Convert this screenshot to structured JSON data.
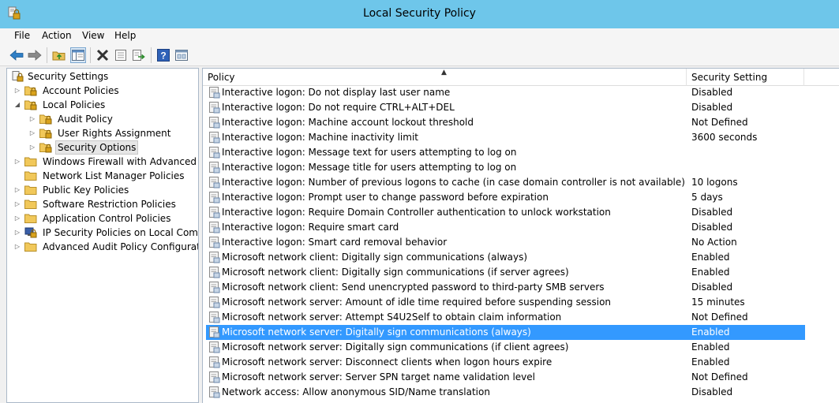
{
  "window": {
    "title": "Local Security Policy"
  },
  "menu": {
    "file": "File",
    "action": "Action",
    "view": "View",
    "help": "Help"
  },
  "toolbar": {
    "buttons": [
      "back-icon",
      "forward-icon",
      "up-folder-icon",
      "show-hide-tree-icon",
      "delete-icon",
      "properties-icon",
      "export-list-icon",
      "help-icon",
      "console-icon"
    ]
  },
  "tree": {
    "root": "Security Settings",
    "items": [
      {
        "label": "Account Policies"
      },
      {
        "label": "Local Policies"
      },
      {
        "label": "Audit Policy"
      },
      {
        "label": "User Rights Assignment"
      },
      {
        "label": "Security Options"
      },
      {
        "label": "Windows Firewall with Advanced Security"
      },
      {
        "label": "Network List Manager Policies"
      },
      {
        "label": "Public Key Policies"
      },
      {
        "label": "Software Restriction Policies"
      },
      {
        "label": "Application Control Policies"
      },
      {
        "label": "IP Security Policies on Local Computer"
      },
      {
        "label": "Advanced Audit Policy Configuration"
      }
    ]
  },
  "list": {
    "columns": {
      "policy": "Policy",
      "setting": "Security Setting"
    },
    "rows": [
      {
        "policy": "Interactive logon: Do not display last user name",
        "setting": "Disabled"
      },
      {
        "policy": "Interactive logon: Do not require CTRL+ALT+DEL",
        "setting": "Disabled"
      },
      {
        "policy": "Interactive logon: Machine account lockout threshold",
        "setting": "Not Defined"
      },
      {
        "policy": "Interactive logon: Machine inactivity limit",
        "setting": "3600 seconds"
      },
      {
        "policy": "Interactive logon: Message text for users attempting to log on",
        "setting": ""
      },
      {
        "policy": "Interactive logon: Message title for users attempting to log on",
        "setting": ""
      },
      {
        "policy": "Interactive logon: Number of previous logons to cache (in case domain controller is not available)",
        "setting": "10 logons"
      },
      {
        "policy": "Interactive logon: Prompt user to change password before expiration",
        "setting": "5 days"
      },
      {
        "policy": "Interactive logon: Require Domain Controller authentication to unlock workstation",
        "setting": "Disabled"
      },
      {
        "policy": "Interactive logon: Require smart card",
        "setting": "Disabled"
      },
      {
        "policy": "Interactive logon: Smart card removal behavior",
        "setting": "No Action"
      },
      {
        "policy": "Microsoft network client: Digitally sign communications (always)",
        "setting": "Enabled"
      },
      {
        "policy": "Microsoft network client: Digitally sign communications (if server agrees)",
        "setting": "Enabled"
      },
      {
        "policy": "Microsoft network client: Send unencrypted password to third-party SMB servers",
        "setting": "Disabled"
      },
      {
        "policy": "Microsoft network server: Amount of idle time required before suspending session",
        "setting": "15 minutes"
      },
      {
        "policy": "Microsoft network server: Attempt S4U2Self to obtain claim information",
        "setting": "Not Defined"
      },
      {
        "policy": "Microsoft network server: Digitally sign communications (always)",
        "setting": "Enabled"
      },
      {
        "policy": "Microsoft network server: Digitally sign communications (if client agrees)",
        "setting": "Enabled"
      },
      {
        "policy": "Microsoft network server: Disconnect clients when logon hours expire",
        "setting": "Enabled"
      },
      {
        "policy": "Microsoft network server: Server SPN target name validation level",
        "setting": "Not Defined"
      },
      {
        "policy": "Network access: Allow anonymous SID/Name translation",
        "setting": "Disabled"
      }
    ]
  },
  "colors": {
    "titlebar": "#6ec6ea",
    "selection": "#3399ff"
  }
}
